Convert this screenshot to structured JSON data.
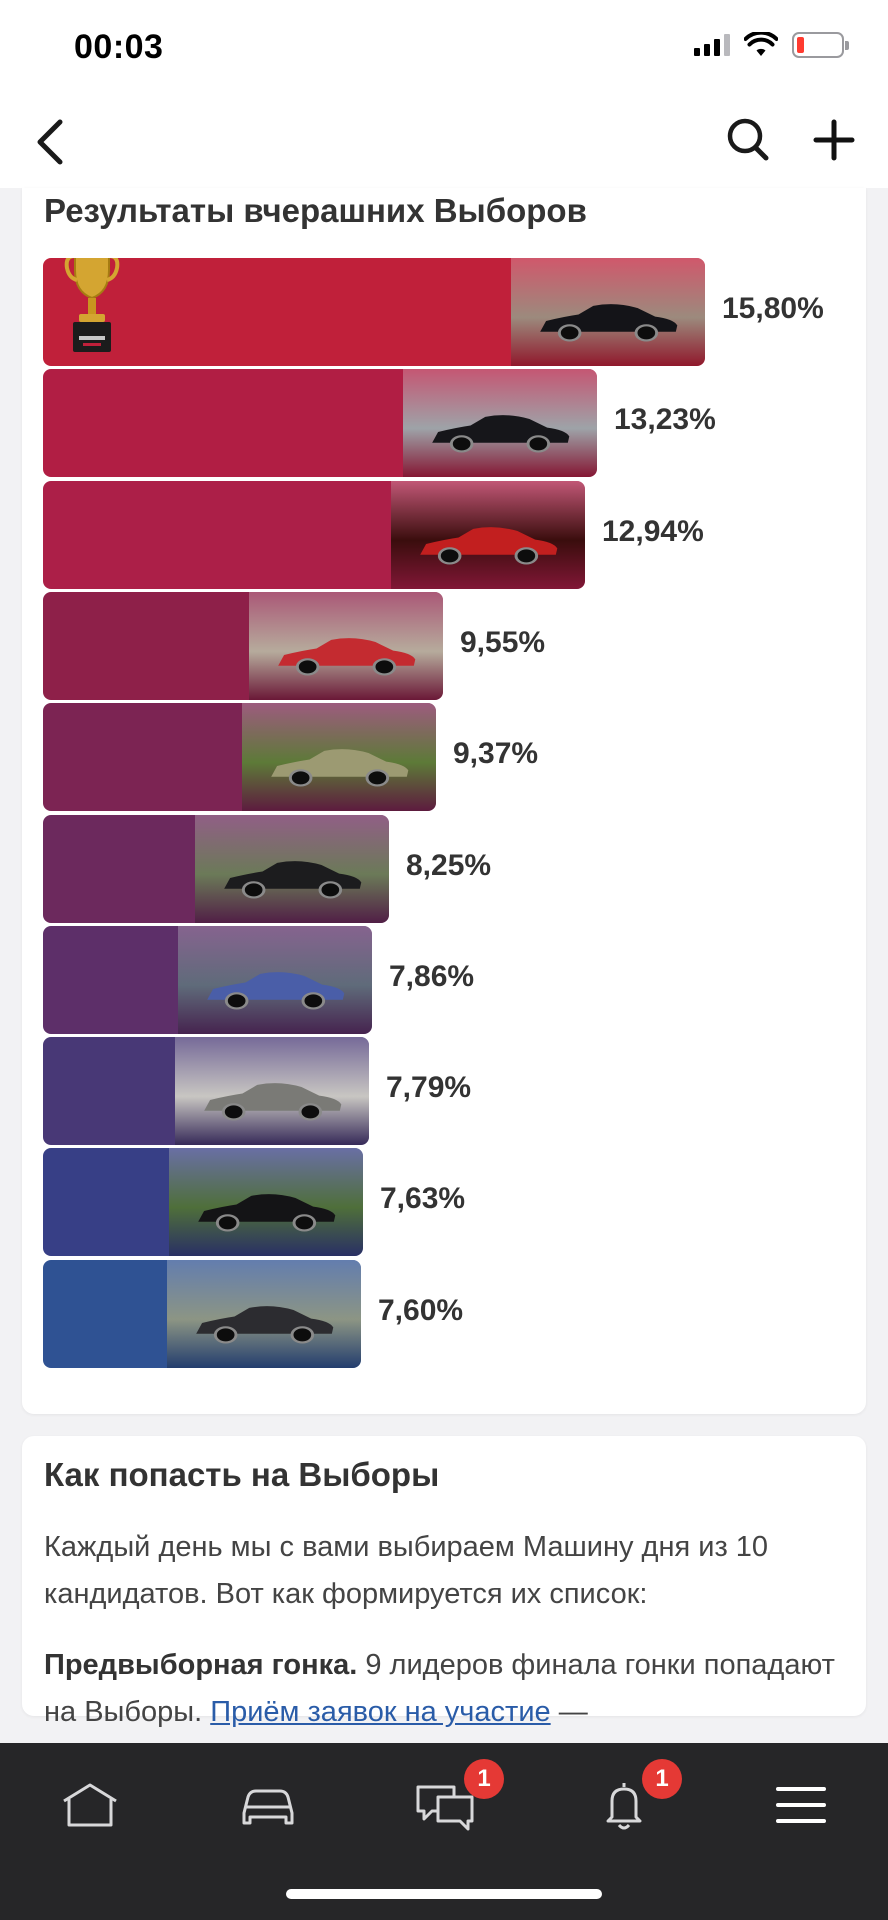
{
  "status_bar": {
    "time": "00:03"
  },
  "results": {
    "title": "Результаты вчерашних Выборов",
    "items": [
      {
        "percent": "15,80%",
        "value": 15.8,
        "color": "#c0203a",
        "photo_bg": "#9c8a7d",
        "car_color": "#141418"
      },
      {
        "percent": "13,23%",
        "value": 13.23,
        "color": "#b11e44",
        "photo_bg": "#9ea3a8",
        "car_color": "#16161a"
      },
      {
        "percent": "12,94%",
        "value": 12.94,
        "color": "#ac1f48",
        "photo_bg": "#3a0d0d",
        "car_color": "#c21f1f"
      },
      {
        "percent": "9,55%",
        "value": 9.55,
        "color": "#8e2049",
        "photo_bg": "#b6ab9c",
        "car_color": "#c42b30"
      },
      {
        "percent": "9,37%",
        "value": 9.37,
        "color": "#7c2453",
        "photo_bg": "#5d7a38",
        "car_color": "#9c9a72"
      },
      {
        "percent": "8,25%",
        "value": 8.25,
        "color": "#6c295d",
        "photo_bg": "#6b7a58",
        "car_color": "#1c1c1e"
      },
      {
        "percent": "7,86%",
        "value": 7.86,
        "color": "#5d2f69",
        "photo_bg": "#5f6b7a",
        "car_color": "#4a5ea8"
      },
      {
        "percent": "7,79%",
        "value": 7.79,
        "color": "#483876",
        "photo_bg": "#c8c6c2",
        "car_color": "#7a7a76"
      },
      {
        "percent": "7,63%",
        "value": 7.63,
        "color": "#373f86",
        "photo_bg": "#4f6f3a",
        "car_color": "#141416"
      },
      {
        "percent": "7,60%",
        "value": 7.6,
        "color": "#2f5293",
        "photo_bg": "#8c9584",
        "car_color": "#2c2c30"
      }
    ]
  },
  "info": {
    "title": "Как попасть на Выборы",
    "paragraph1": "Каждый день мы с вами выбираем Машину дня из 10 кандидатов. Вот как формируется их список:",
    "paragraph2_bold": "Предвыборная гонка.",
    "paragraph2_text": " 9 лидеров финала гонки попадают на Выборы. ",
    "paragraph2_link": "Приём заявок на участие",
    "paragraph2_tail": " —"
  },
  "tab_bar": {
    "tabs": [
      "home-icon",
      "garage-car-icon",
      "messages-icon",
      "notifications-bell-icon",
      "menu-icon"
    ],
    "messages_badge": "1",
    "notifications_badge": "1"
  }
}
